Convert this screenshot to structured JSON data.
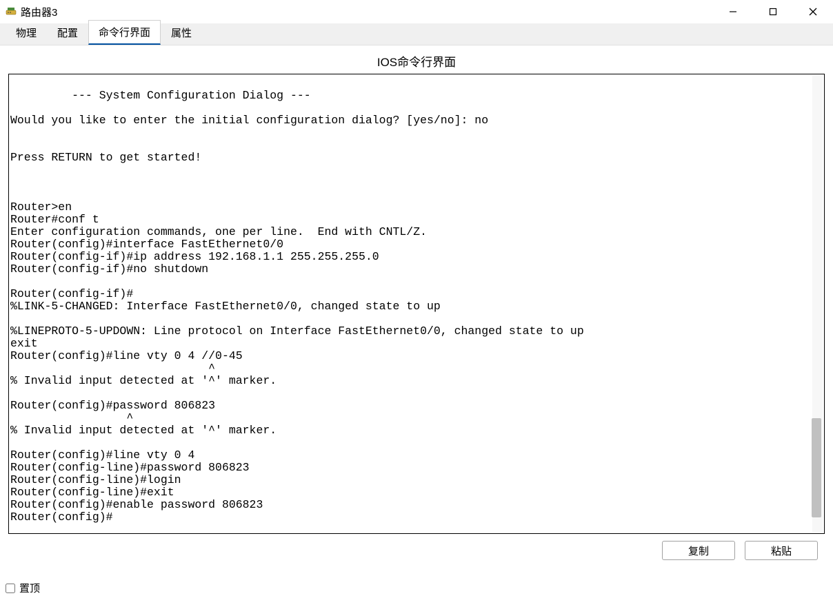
{
  "window": {
    "title": "路由器3"
  },
  "tabs": [
    {
      "label": "物理",
      "active": false
    },
    {
      "label": "配置",
      "active": false
    },
    {
      "label": "命令行界面",
      "active": true
    },
    {
      "label": "属性",
      "active": false
    }
  ],
  "subtitle": "IOS命令行界面",
  "cli_text": "\n         --- System Configuration Dialog ---\n\nWould you like to enter the initial configuration dialog? [yes/no]: no\n\n\nPress RETURN to get started!\n\n\n\nRouter>en\nRouter#conf t\nEnter configuration commands, one per line.  End with CNTL/Z.\nRouter(config)#interface FastEthernet0/0\nRouter(config-if)#ip address 192.168.1.1 255.255.255.0\nRouter(config-if)#no shutdown\n\nRouter(config-if)#\n%LINK-5-CHANGED: Interface FastEthernet0/0, changed state to up\n\n%LINEPROTO-5-UPDOWN: Line protocol on Interface FastEthernet0/0, changed state to up\nexit\nRouter(config)#line vty 0 4 //0-45\n                             ^\n% Invalid input detected at '^' marker.\n\t\nRouter(config)#password 806823\n                 ^\n% Invalid input detected at '^' marker.\n\t\nRouter(config)#line vty 0 4\nRouter(config-line)#password 806823\nRouter(config-line)#login\nRouter(config-line)#exit\nRouter(config)#enable password 806823\nRouter(config)#",
  "buttons": {
    "copy": "复制",
    "paste": "粘贴"
  },
  "footer": {
    "topmost": "置顶"
  }
}
